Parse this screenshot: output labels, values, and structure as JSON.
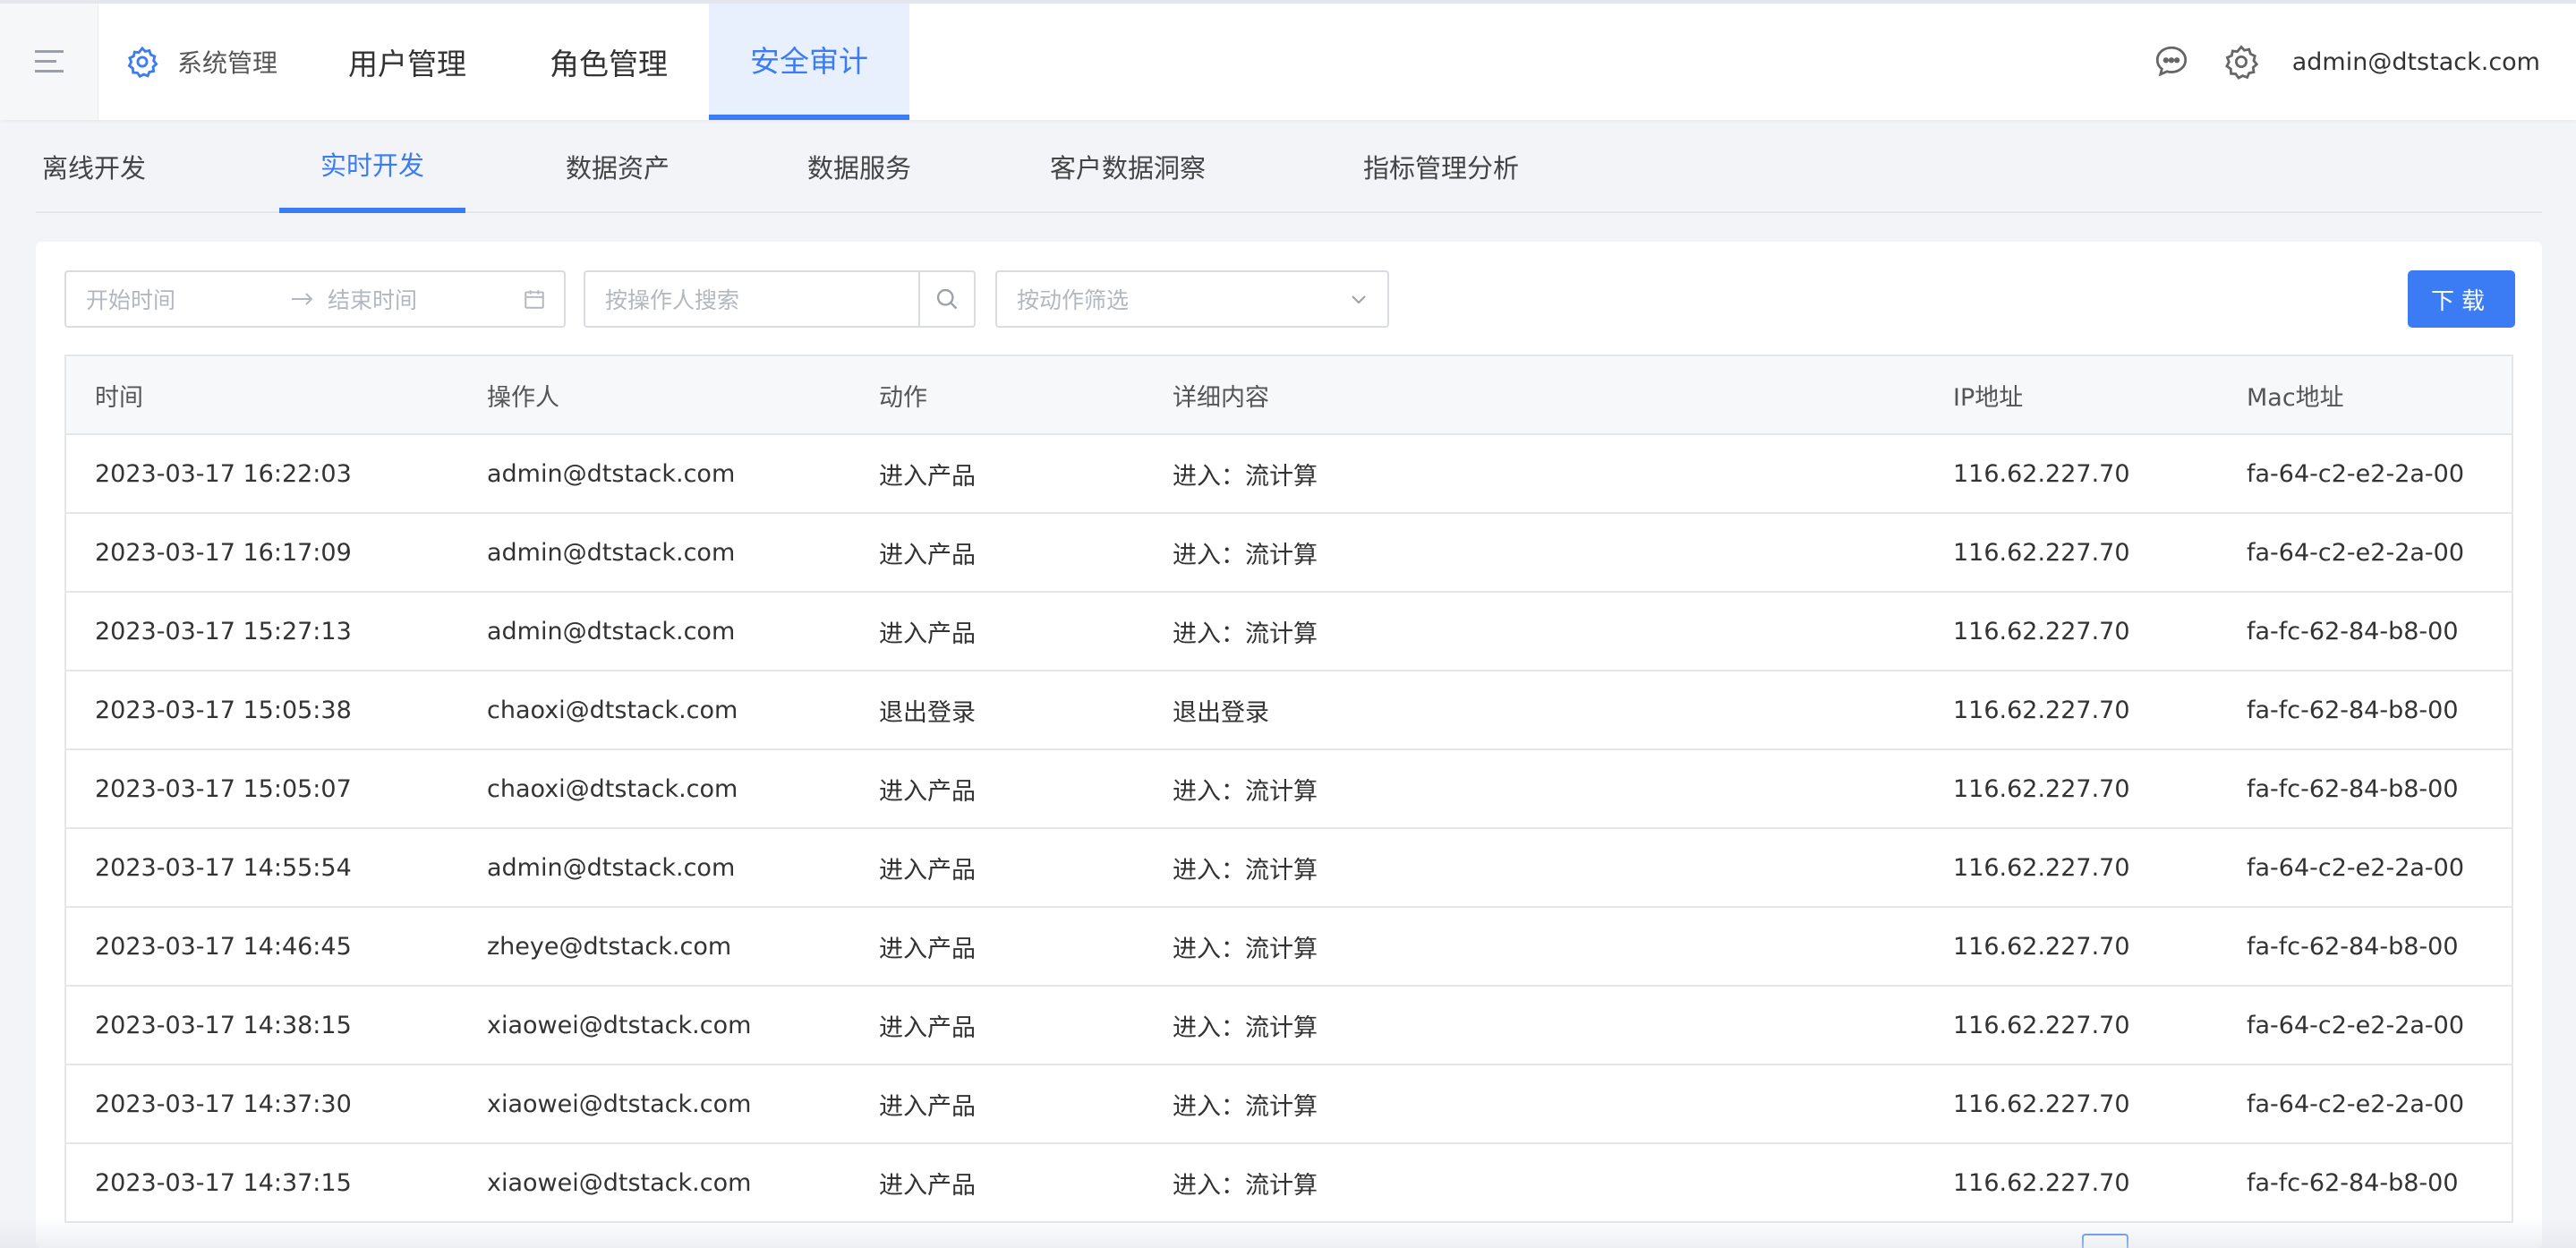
{
  "header": {
    "system_label": "系统管理",
    "nav_tabs": [
      "用户管理",
      "角色管理",
      "安全审计"
    ],
    "user": "admin@dtstack.com"
  },
  "subtabs": [
    "离线开发",
    "实时开发",
    "数据资产",
    "数据服务",
    "客户数据洞察",
    "指标管理分析"
  ],
  "filters": {
    "start_placeholder": "开始时间",
    "end_placeholder": "结束时间",
    "operator_placeholder": "按操作人搜索",
    "action_placeholder": "按动作筛选",
    "download_label": "下载"
  },
  "table": {
    "columns": [
      "时间",
      "操作人",
      "动作",
      "详细内容",
      "IP地址",
      "Mac地址"
    ],
    "rows": [
      [
        "2023-03-17 16:22:03",
        "admin@dtstack.com",
        "进入产品",
        "进入：流计算",
        "116.62.227.70",
        "fa-64-c2-e2-2a-00"
      ],
      [
        "2023-03-17 16:17:09",
        "admin@dtstack.com",
        "进入产品",
        "进入：流计算",
        "116.62.227.70",
        "fa-64-c2-e2-2a-00"
      ],
      [
        "2023-03-17 15:27:13",
        "admin@dtstack.com",
        "进入产品",
        "进入：流计算",
        "116.62.227.70",
        "fa-fc-62-84-b8-00"
      ],
      [
        "2023-03-17 15:05:38",
        "chaoxi@dtstack.com",
        "退出登录",
        "退出登录",
        "116.62.227.70",
        "fa-fc-62-84-b8-00"
      ],
      [
        "2023-03-17 15:05:07",
        "chaoxi@dtstack.com",
        "进入产品",
        "进入：流计算",
        "116.62.227.70",
        "fa-fc-62-84-b8-00"
      ],
      [
        "2023-03-17 14:55:54",
        "admin@dtstack.com",
        "进入产品",
        "进入：流计算",
        "116.62.227.70",
        "fa-64-c2-e2-2a-00"
      ],
      [
        "2023-03-17 14:46:45",
        "zheye@dtstack.com",
        "进入产品",
        "进入：流计算",
        "116.62.227.70",
        "fa-fc-62-84-b8-00"
      ],
      [
        "2023-03-17 14:38:15",
        "xiaowei@dtstack.com",
        "进入产品",
        "进入：流计算",
        "116.62.227.70",
        "fa-64-c2-e2-2a-00"
      ],
      [
        "2023-03-17 14:37:30",
        "xiaowei@dtstack.com",
        "进入产品",
        "进入：流计算",
        "116.62.227.70",
        "fa-64-c2-e2-2a-00"
      ],
      [
        "2023-03-17 14:37:15",
        "xiaowei@dtstack.com",
        "进入产品",
        "进入：流计算",
        "116.62.227.70",
        "fa-fc-62-84-b8-00"
      ]
    ]
  },
  "colors": {
    "accent": "#3b7cf4",
    "active_tab_bg": "#e8f0fe",
    "page_bg": "#f2f4f8"
  },
  "icons": {
    "menu": "menu-icon",
    "system": "gear-icon",
    "message": "chat-bubble-icon",
    "settings": "settings-icon",
    "range_arrow": "arrow-right-icon",
    "calendar": "calendar-icon",
    "search": "search-icon",
    "dropdown": "chevron-down-icon"
  }
}
